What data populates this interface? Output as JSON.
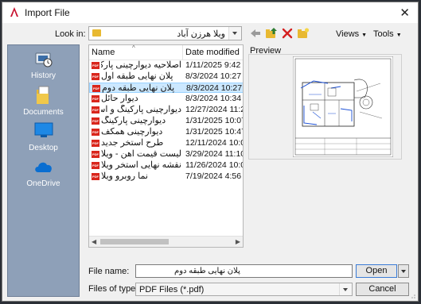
{
  "window": {
    "title": "Import File",
    "close_glyph": "✕"
  },
  "lookin": {
    "label": "Look in:",
    "value": "ویلا هرزن آباد"
  },
  "toolbar": {
    "views_label": "Views",
    "tools_label": "Tools",
    "icons": [
      "back-arrow-icon",
      "up-folder-icon",
      "delete-icon",
      "new-folder-icon"
    ]
  },
  "places": [
    {
      "label": "History",
      "icon": "history-icon"
    },
    {
      "label": "Documents",
      "icon": "documents-icon"
    },
    {
      "label": "Desktop",
      "icon": "desktop-icon"
    },
    {
      "label": "OneDrive",
      "icon": "onedrive-icon"
    }
  ],
  "filelist": {
    "col_name": "Name",
    "col_date": "Date modified",
    "file_icon": "pdf-icon",
    "pdf_badge": "PDF",
    "files": [
      {
        "name": "اصلاحیه دیوارچینی پارکی",
        "date": "1/11/2025 9:42 PM",
        "selected": false
      },
      {
        "name": "پلان نهایی طبقه اول",
        "date": "8/3/2024 10:27 PM",
        "selected": false
      },
      {
        "name": "پلان نهایی طبقه دوم",
        "date": "8/3/2024 10:27 PM",
        "selected": true
      },
      {
        "name": "دیوار حائل",
        "date": "8/3/2024 10:34 AM",
        "selected": false
      },
      {
        "name": "دیوارچینی پارکینگ و استخر",
        "date": "12/27/2024 11:23 P",
        "selected": false
      },
      {
        "name": "دیوارچینی پارکینگ",
        "date": "1/31/2025 10:07 PM",
        "selected": false
      },
      {
        "name": "دیوارچینی همکف",
        "date": "1/31/2025 10:47 PM",
        "selected": false
      },
      {
        "name": "طرح استخر جدید",
        "date": "12/11/2024 10:08 P",
        "selected": false
      },
      {
        "name": "لیست قیمت آهن - ویلا م",
        "date": "3/29/2024 11:10 PM",
        "selected": false
      },
      {
        "name": "نقشه نهایی استخر ویلا",
        "date": "11/26/2024 10:00 P",
        "selected": false
      },
      {
        "name": "نما روبرو ویلا",
        "date": "7/19/2024 4:56 PM",
        "selected": false
      }
    ]
  },
  "preview": {
    "label": "Preview"
  },
  "footer": {
    "filename_label": "File name:",
    "filename_value": "پلان نهایی طبقه دوم",
    "filetype_label": "Files of type:",
    "filetype_value": "PDF Files (*.pdf)",
    "open_label": "Open",
    "cancel_label": "Cancel"
  },
  "colors": {
    "places_bg": "#8ea0b8",
    "selection": "#cce8ff",
    "pdf_red": "#d9261c",
    "delete_red": "#d42020",
    "folder_yellow": "#e8b931"
  }
}
